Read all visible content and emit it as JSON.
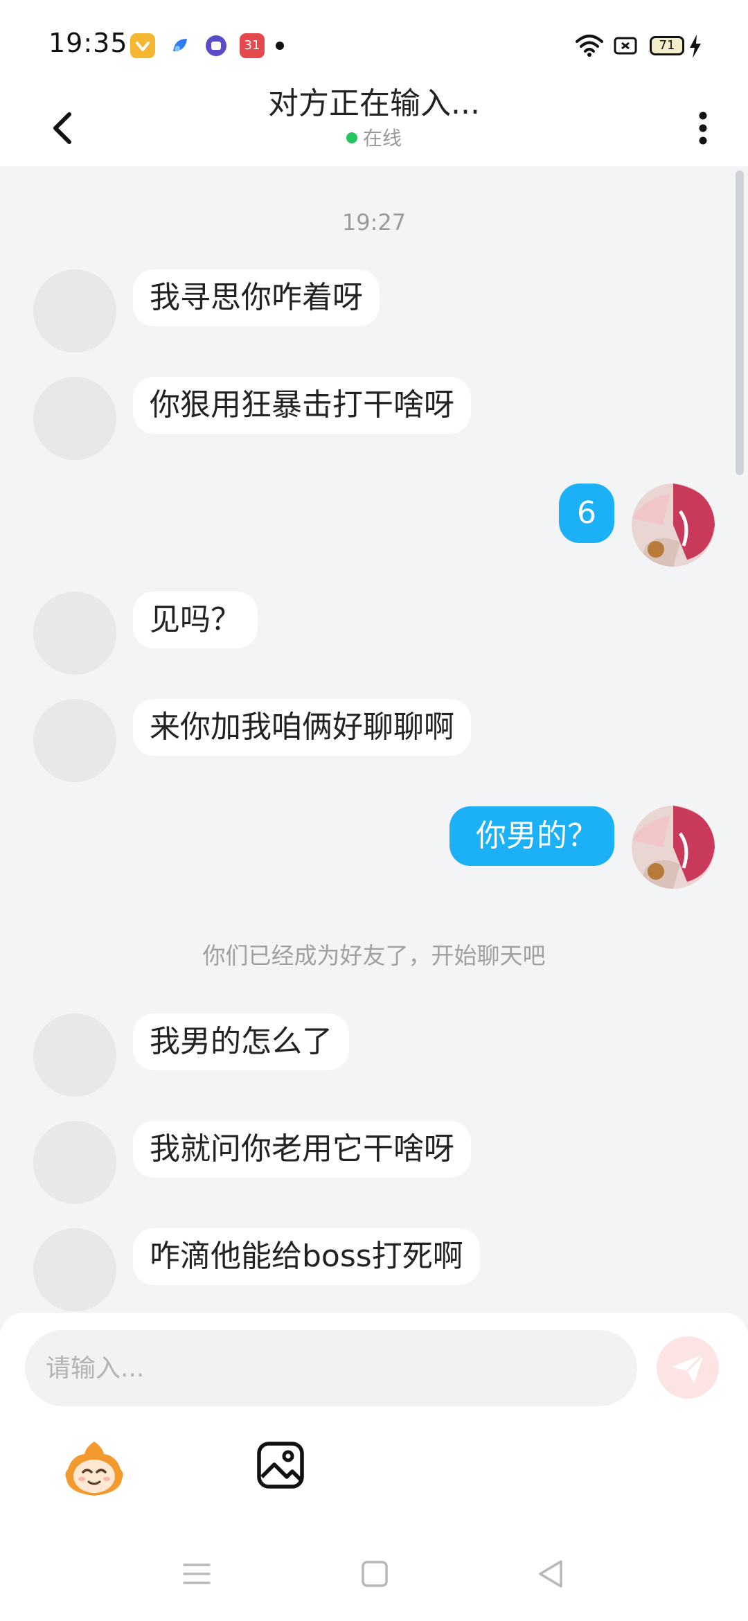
{
  "status_bar": {
    "time": "19:35",
    "battery": "71",
    "app_icons": [
      {
        "name": "vip-app-icon",
        "color": "#f5b731"
      },
      {
        "name": "blue-app-icon",
        "color": "#2f7bf5"
      },
      {
        "name": "purple-app-icon",
        "color": "#5b4cc9"
      },
      {
        "name": "calendar-app-icon",
        "color": "#e5484d",
        "label": "31"
      }
    ]
  },
  "header": {
    "title": "对方正在输入...",
    "presence": "在线"
  },
  "chat": {
    "time_divider": "19:27",
    "messages": [
      {
        "side": "in",
        "text": "我寻思你咋着呀"
      },
      {
        "side": "in",
        "text": "你狠用狂暴击打干啥呀"
      },
      {
        "side": "out",
        "text": "6"
      },
      {
        "side": "in",
        "text": "见吗？"
      },
      {
        "side": "in",
        "text": "来你加我咱俩好聊聊啊"
      },
      {
        "side": "out",
        "text": "你男的？"
      },
      {
        "side": "system",
        "text": "你们已经成为好友了，开始聊天吧"
      },
      {
        "side": "in",
        "text": "我男的怎么了"
      },
      {
        "side": "in",
        "text": "我就问你老用它干啥呀"
      },
      {
        "side": "in",
        "text": "咋滴他能给boss打死啊"
      }
    ]
  },
  "composer": {
    "placeholder": "请输入..."
  },
  "colors": {
    "accent": "#1cb0f6",
    "background": "#f3f4f6",
    "online": "#22c55e"
  }
}
